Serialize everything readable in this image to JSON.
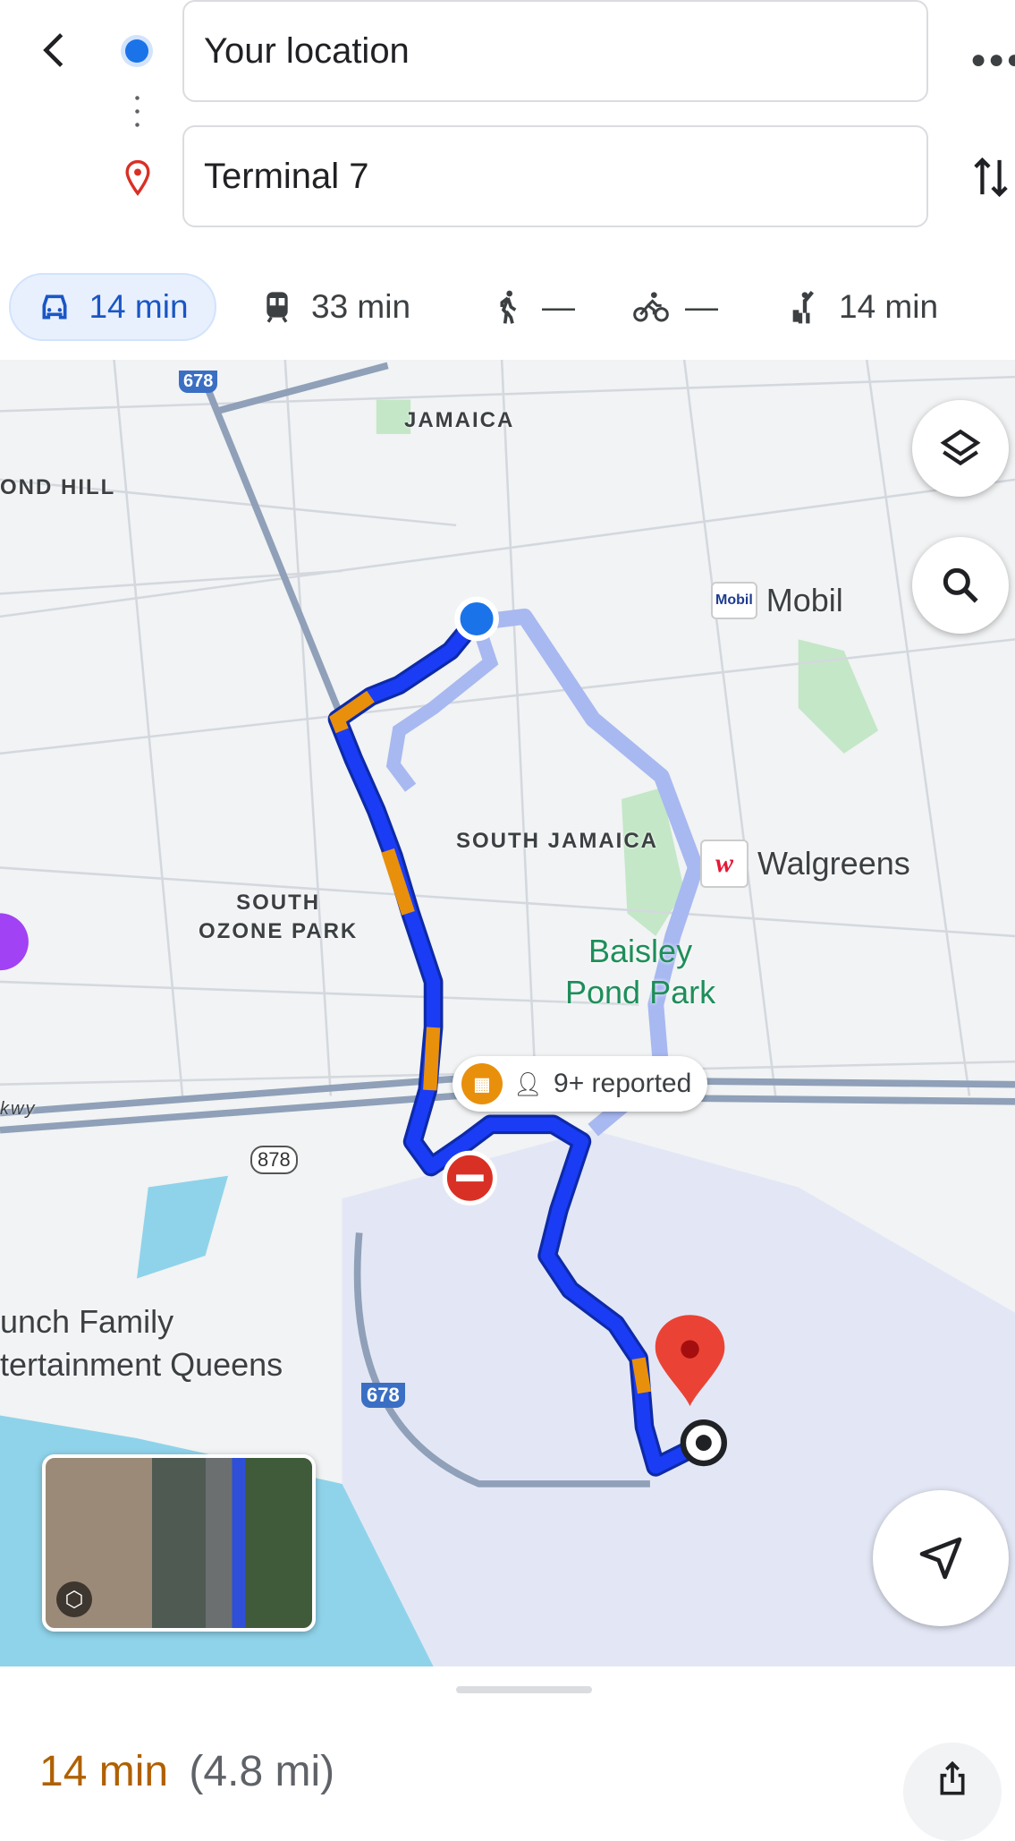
{
  "header": {
    "origin": "Your location",
    "destination": "Terminal 7"
  },
  "modes": [
    {
      "icon": "car-icon",
      "label": "14 min",
      "selected": true
    },
    {
      "icon": "train-icon",
      "label": "33 min"
    },
    {
      "icon": "walk-icon",
      "label": "—"
    },
    {
      "icon": "bike-icon",
      "label": "—"
    },
    {
      "icon": "ride-hail-icon",
      "label": "14 min"
    }
  ],
  "map": {
    "labels": {
      "jamaica": "JAMAICA",
      "richmond_hill": "OND HILL",
      "south_jamaica": "SOUTH JAMAICA",
      "south_ozone_park_1": "SOUTH",
      "south_ozone_park_2": "OZONE PARK",
      "pkwy": "kwy"
    },
    "pois": {
      "mobil": "Mobil",
      "mobil_logo": "Mobil",
      "walgreens": "Walgreens",
      "park_1": "Baisley",
      "park_2": "Pond Park",
      "family_1": "unch Family",
      "family_2": "tertainment Queens"
    },
    "shields": {
      "i678_top": "678",
      "i678_bottom": "678",
      "r878": "878"
    },
    "incident": {
      "text": "9+ reported"
    },
    "colors": {
      "route": "#1a3cf5",
      "traffic": "#e8900c",
      "alt_route": "#a8b8f0",
      "water": "#8fd3ea",
      "park": "#c4e7c7"
    }
  },
  "summary": {
    "time": "14 min",
    "distance": "(4.8 mi)",
    "time_color": "#b06000"
  }
}
